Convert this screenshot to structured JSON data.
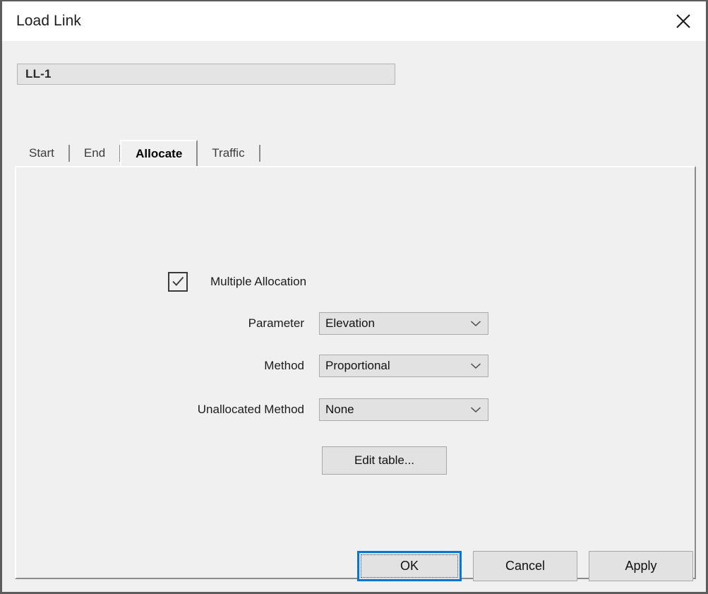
{
  "window": {
    "title": "Load Link",
    "close_icon": "close-icon"
  },
  "name_field": {
    "value": "LL-1"
  },
  "tabs": [
    {
      "label": "Start",
      "selected": false
    },
    {
      "label": "End",
      "selected": false
    },
    {
      "label": "Allocate",
      "selected": true
    },
    {
      "label": "Traffic",
      "selected": false
    }
  ],
  "allocate_panel": {
    "multiple_allocation": {
      "label": "Multiple Allocation",
      "checked": true,
      "check_icon": "checkmark-icon"
    },
    "fields": [
      {
        "label": "Parameter",
        "value": "Elevation",
        "chevron_icon": "chevron-down-icon"
      },
      {
        "label": "Method",
        "value": "Proportional",
        "chevron_icon": "chevron-down-icon"
      },
      {
        "label": "Unallocated Method",
        "value": "None",
        "chevron_icon": "chevron-down-icon"
      }
    ],
    "edit_table_label": "Edit table..."
  },
  "footer": {
    "ok_label": "OK",
    "cancel_label": "Cancel",
    "apply_label": "Apply"
  },
  "colors": {
    "accent": "#0078d7",
    "dialog_bg": "#f0f0f0",
    "titlebar_bg": "#ffffff",
    "control_bg": "#e2e2e2",
    "frame": "#5c5c5c"
  }
}
